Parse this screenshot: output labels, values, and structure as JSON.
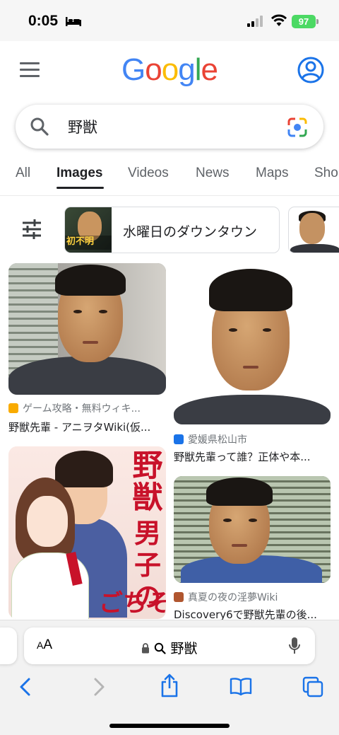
{
  "status_bar": {
    "time": "0:05",
    "battery": "97"
  },
  "header": {
    "logo": {
      "l1": "G",
      "l2": "o",
      "l3": "o",
      "l4": "g",
      "l5": "l",
      "l6": "e"
    },
    "search_query": "野獣"
  },
  "tabs": [
    {
      "label": "All"
    },
    {
      "label": "Images"
    },
    {
      "label": "Videos"
    },
    {
      "label": "News"
    },
    {
      "label": "Maps"
    },
    {
      "label": "Sho"
    }
  ],
  "active_tab": "Images",
  "chips": [
    {
      "label": "水曜日のダウンタウン",
      "thumb_caption": "初不明"
    }
  ],
  "results": [
    {
      "source": "ゲーム攻略・無料ウィキ...",
      "title": "野獣先輩 - アニヲタWiki(仮..."
    },
    {
      "source": "愛媛県松山市",
      "title": "野獣先輩って誰？正体や本..."
    },
    {
      "source": "",
      "title": "",
      "cover_title_1": "野獣",
      "cover_title_2": "男子の",
      "cover_title_3": "ごちそ"
    },
    {
      "source": "真夏の夜の淫夢Wiki",
      "title": "Discovery6で野獣先輩の後..."
    }
  ],
  "safari": {
    "text_size_label_small": "A",
    "text_size_label": "A",
    "url": "野獣"
  },
  "colors": {
    "google_blue": "#4285f4",
    "google_red": "#ea4335",
    "google_yellow": "#fbbc05",
    "google_green": "#34a853",
    "battery_green": "#4cd964",
    "safari_blue": "#1a73e8"
  },
  "icons": [
    "bed-icon",
    "signal-icon",
    "wifi-icon",
    "menu-icon",
    "account-icon",
    "search-icon",
    "camera-lens-icon",
    "filter-icon",
    "lock-icon",
    "magnifier-icon",
    "mic-icon",
    "back-icon",
    "forward-icon",
    "share-icon",
    "bookmarks-icon",
    "tabs-icon"
  ]
}
